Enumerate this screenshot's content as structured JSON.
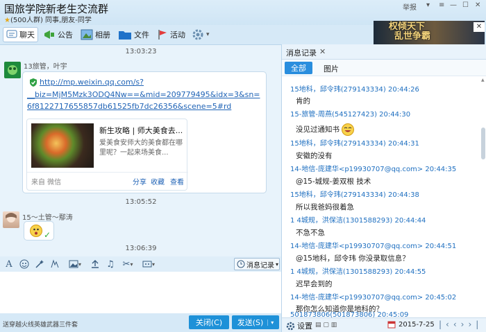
{
  "window": {
    "title": "国旅学院新老生交流群",
    "subtitle": "(500人群) 同事,朋友-同学",
    "report_label": "举报"
  },
  "toolbar": {
    "items": [
      {
        "label": "聊天",
        "icon": "chat-icon"
      },
      {
        "label": "公告",
        "icon": "megaphone-icon"
      },
      {
        "label": "相册",
        "icon": "photo-album-icon"
      },
      {
        "label": "文件",
        "icon": "folder-icon"
      },
      {
        "label": "活动",
        "icon": "flag-icon"
      }
    ]
  },
  "ad": {
    "line1": "权倾天下",
    "line2": "乱世争霸"
  },
  "chat": {
    "timestamps": [
      "13:03:23",
      "13:05:52",
      "13:06:39"
    ],
    "messages": [
      {
        "sender": "13旅管，叶宇",
        "link_lines": [
          "http://mp.weixin.qq.com/s?",
          "__biz=MjM5Mzk3ODQ4Nw==&mid=209779495&idx=3&sn=",
          "6f8122717655857db61525fb7dc26356&scene=5#rd"
        ],
        "card": {
          "title": "新生攻略 | 师大美食去...",
          "desc": "爱美食安师大的美食都在哪里呢？一起来场美食...",
          "source": "来自 微信",
          "actions": [
            "分享",
            "收藏",
            "查看"
          ]
        }
      },
      {
        "sender": "15～土管～鄢涛"
      }
    ]
  },
  "input": {
    "msglog_label": "消息记录",
    "close_label": "关闭(C)",
    "send_label": "发送(S)",
    "footer": "送穿越火线英雄武器三件套"
  },
  "history": {
    "tab_label": "消息记录",
    "filters": {
      "all": "全部",
      "images": "图片"
    },
    "entries": [
      {
        "header": "15地科，邱令玮(279143334) 20:44:26",
        "text": "肯的"
      },
      {
        "header": "15-旅管-周燕(545127423) 20:44:30",
        "text": "没见过通知书"
      },
      {
        "header": "15地科，邱令玮(279143334) 20:44:31",
        "text": "安徽的没有"
      },
      {
        "header": "14-地信-庞建华<p19930707@qq.com> 20:44:35",
        "text": "@15-城规-姜双根 技术"
      },
      {
        "header": "15地科，邱令玮(279143334) 20:44:38",
        "text": "所以我爸妈很着急"
      },
      {
        "header": "1 4城规，洪保洁(1301588293) 20:44:44",
        "text": "不急不急"
      },
      {
        "header": "14-地信-庞建华<p19930707@qq.com> 20:44:51",
        "text": "@15地科，邱令玮 你没录取信息？"
      },
      {
        "header": "1 4城规，洪保洁(1301588293) 20:44:55",
        "text": "迟早会到的"
      },
      {
        "header": "14-地信-庞建华<p19930707@qq.com> 20:45:02",
        "text": "那你怎么知道你是地科的？"
      },
      {
        "header": "501873806(501873806) 20:45:09",
        "text": ""
      }
    ],
    "settings_label": "设置",
    "date": "2015-7-25"
  }
}
